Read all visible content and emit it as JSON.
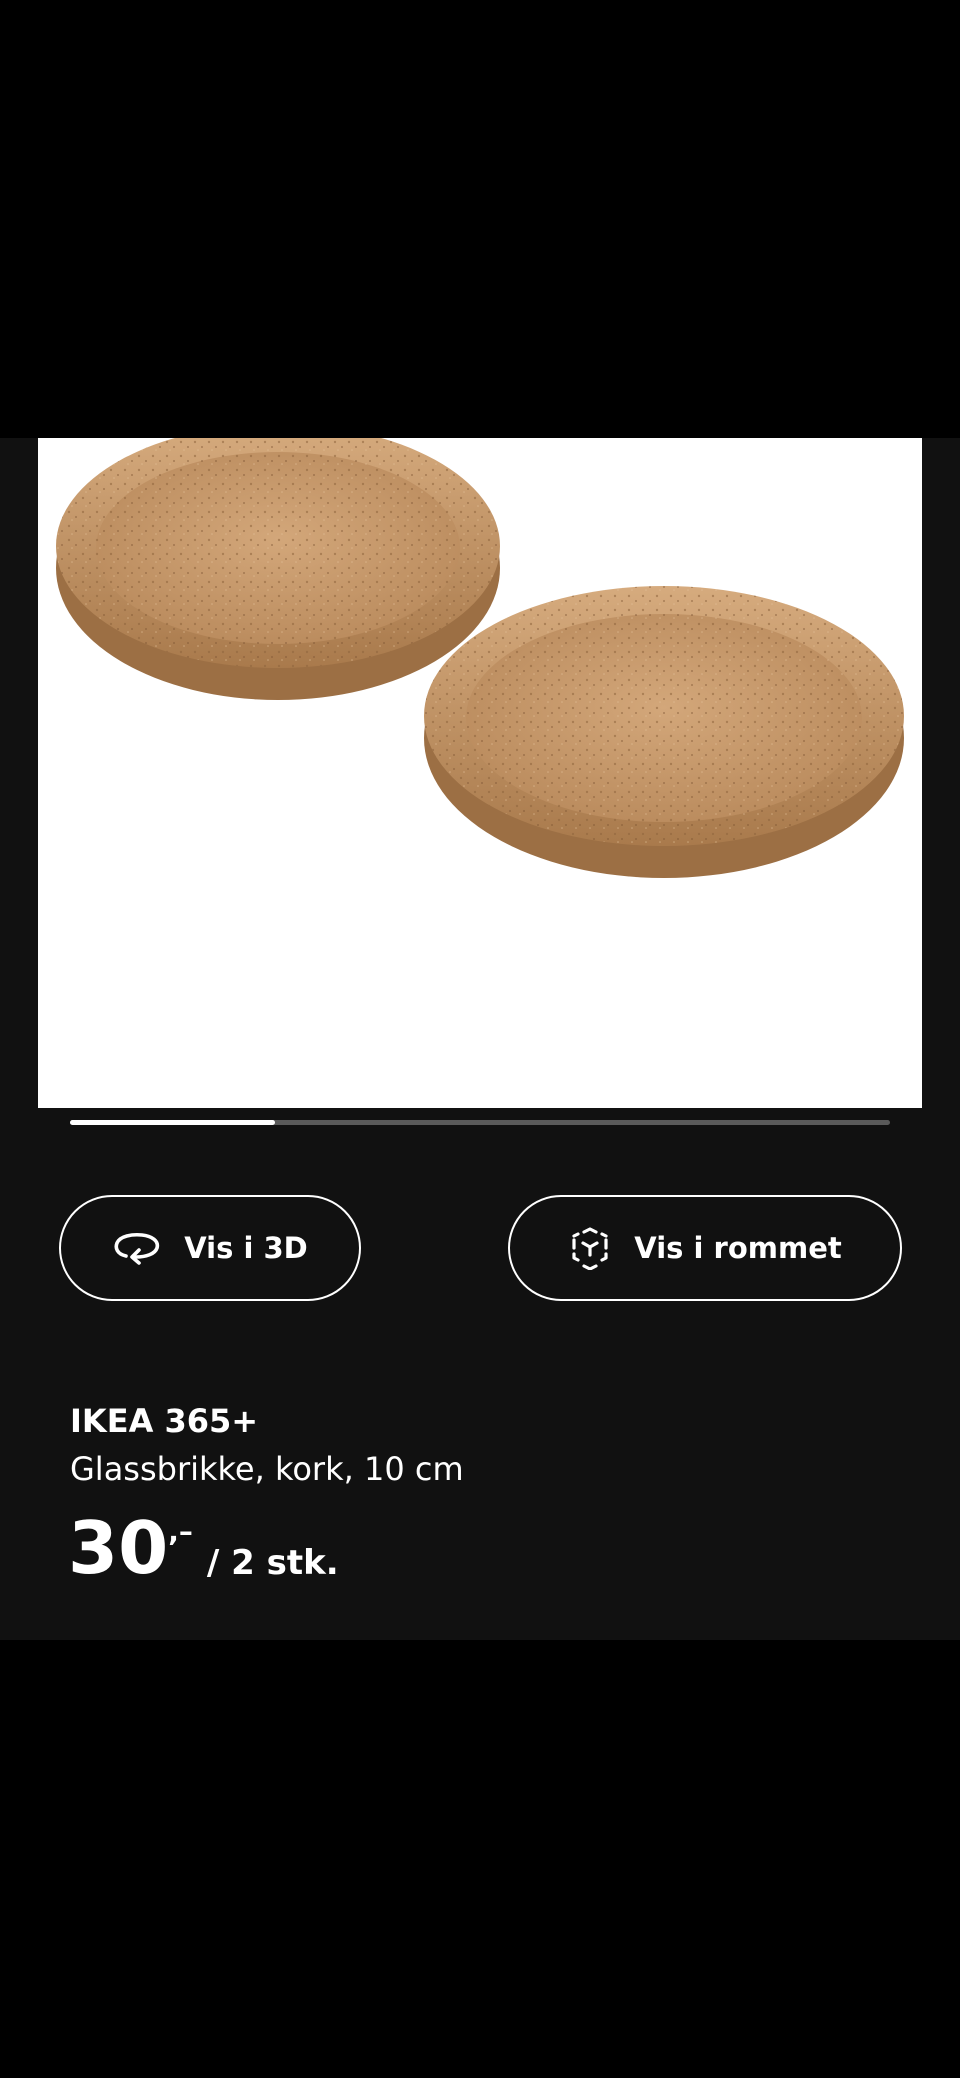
{
  "carousel": {
    "progress": 0.25
  },
  "actions": {
    "view_3d_label": "Vis i 3D",
    "view_in_room_label": "Vis i rommet"
  },
  "product": {
    "brand": "IKEA 365+",
    "description": "Glassbrikke, kork, 10 cm",
    "price_integer": "30",
    "price_decimal": ",–",
    "price_unit": "/ 2 stk."
  },
  "icons": {
    "view_3d": "rotate-3d-icon",
    "view_in_room": "ar-cube-icon"
  },
  "colors": {
    "panel_bg": "#111111",
    "image_bg": "#ffffff",
    "cork": "#c99a6a",
    "track": "#5a5a5a"
  }
}
